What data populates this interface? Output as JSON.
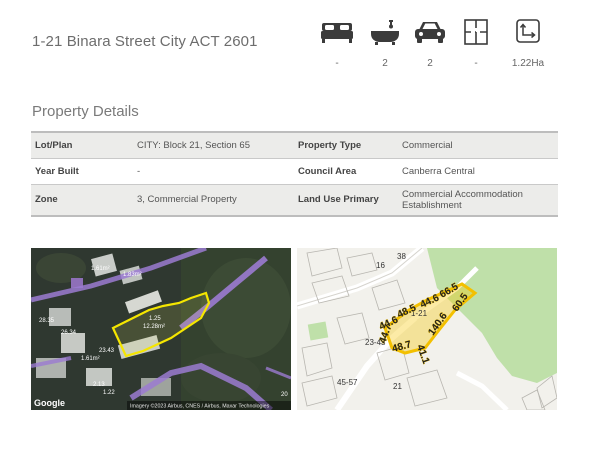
{
  "address": "1-21 Binara Street City ACT 2601",
  "features": [
    {
      "icon": "bed-icon",
      "value": "-"
    },
    {
      "icon": "bath-icon",
      "value": "2"
    },
    {
      "icon": "car-icon",
      "value": "2"
    },
    {
      "icon": "floorplan-icon",
      "value": "-"
    },
    {
      "icon": "land-area-icon",
      "value": "1.22Ha"
    }
  ],
  "section_title": "Property Details",
  "details": [
    {
      "k1": "Lot/Plan",
      "v1": "CITY: Block 21, Section 65",
      "k2": "Property Type",
      "v2": "Commercial"
    },
    {
      "k1": "Year Built",
      "v1": "-",
      "k2": "Council Area",
      "v2": "Canberra Central"
    },
    {
      "k1": "Zone",
      "v1": "3, Commercial Property",
      "k2": "Land Use Primary",
      "v2": "Commercial Accommodation Establishment"
    }
  ],
  "aerial_map": {
    "google_logo": "Google",
    "attribution": "Imagery ©2023 Airbus, CNES / Airbus, Maxar Technologies",
    "labels": [
      "1.61m²",
      "1.83m²",
      "12.28m²",
      "1.25",
      "26.34",
      "23.43",
      "1.61m²",
      "2.13",
      "28.35",
      "1.22",
      "20"
    ]
  },
  "street_map": {
    "labels": [
      "16",
      "38",
      "1-21",
      "23-43",
      "45-57",
      "21"
    ],
    "boundary_labels": [
      "44.6",
      "48.5",
      "44.6",
      "66.5",
      "140.6",
      "60.5",
      "44.7",
      "48.7",
      "41.1"
    ]
  }
}
